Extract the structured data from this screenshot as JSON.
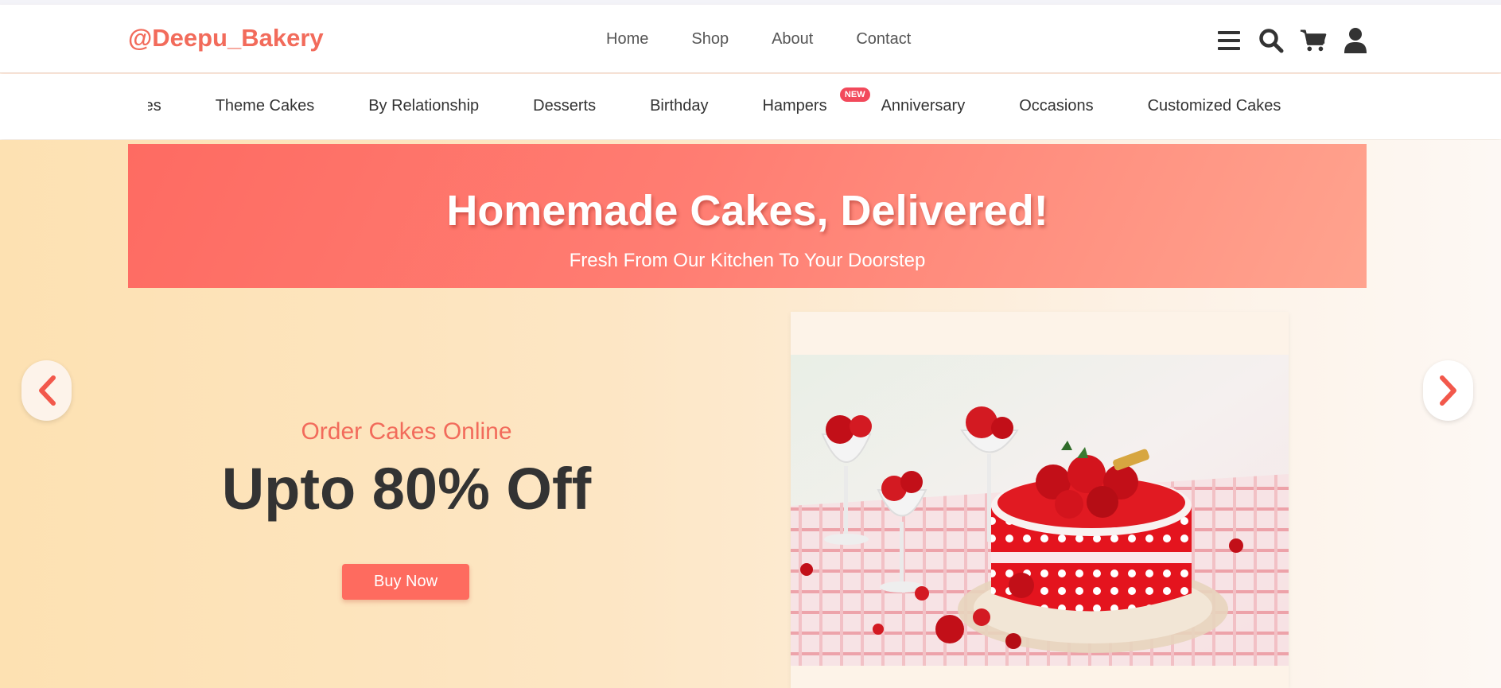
{
  "brand": {
    "logo": "@Deepu_Bakery",
    "accent": "#f26b5b"
  },
  "nav": {
    "items": [
      "Home",
      "Shop",
      "About",
      "Contact"
    ]
  },
  "header_icons": [
    "menu-icon",
    "search-icon",
    "cart-icon",
    "user-icon"
  ],
  "categories": {
    "items": [
      {
        "label": "Cakes"
      },
      {
        "label": "Theme Cakes"
      },
      {
        "label": "By Relationship"
      },
      {
        "label": "Desserts"
      },
      {
        "label": "Birthday"
      },
      {
        "label": "Hampers",
        "badge": "NEW"
      },
      {
        "label": "Anniversary"
      },
      {
        "label": "Occasions"
      },
      {
        "label": "Customized Cakes"
      }
    ]
  },
  "banner": {
    "title": "Homemade Cakes, Delivered!",
    "subtitle": "Fresh From Our Kitchen To Your Doorstep"
  },
  "slide": {
    "subheading": "Order Cakes Online",
    "offer": "Upto 80% Off",
    "button": "Buy Now",
    "image_alt": "Red polka-dot cake with roses"
  },
  "carousel": {
    "prev_icon": "chevron-left-icon",
    "next_icon": "chevron-right-icon"
  }
}
